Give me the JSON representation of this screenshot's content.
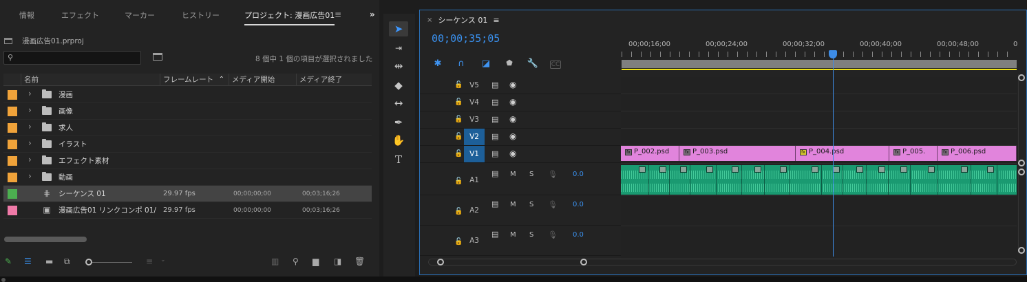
{
  "project_panel": {
    "tabs": [
      "情報",
      "エフェクト",
      "マーカー",
      "ヒストリー",
      "プロジェクト: 漫画広告01"
    ],
    "menu_icon": "hamburger-icon",
    "expand_icon": "double-chevron-right",
    "project_file": "漫画広告01.prproj",
    "search_value": "",
    "item_count_text": "8 個中 1 個の項目が選択されました",
    "columns": [
      "名前",
      "フレームレート",
      "メディア開始",
      "メディア終了"
    ],
    "items": [
      {
        "name": "漫画",
        "type": "bin",
        "color": "#f0a33a",
        "fps": "",
        "start": "",
        "end": ""
      },
      {
        "name": "画像",
        "type": "bin",
        "color": "#f0a33a",
        "fps": "",
        "start": "",
        "end": ""
      },
      {
        "name": "求人",
        "type": "bin",
        "color": "#f0a33a",
        "fps": "",
        "start": "",
        "end": ""
      },
      {
        "name": "イラスト",
        "type": "bin",
        "color": "#f0a33a",
        "fps": "",
        "start": "",
        "end": ""
      },
      {
        "name": "エフェクト素材",
        "type": "bin",
        "color": "#f0a33a",
        "fps": "",
        "start": "",
        "end": ""
      },
      {
        "name": "動画",
        "type": "bin",
        "color": "#f0a33a",
        "fps": "",
        "start": "",
        "end": ""
      },
      {
        "name": "シーケンス 01",
        "type": "sequence",
        "color": "#4caf50",
        "fps": "29.97 fps",
        "start": "00;00;00;00",
        "end": "00;03;16;26",
        "selected": true
      },
      {
        "name": "漫画広告01 リンクコンポ 01/",
        "type": "comp",
        "color": "#f07aa8",
        "fps": "29.97 fps",
        "start": "00;00;00;00",
        "end": "00;03;16;26"
      }
    ]
  },
  "timeline": {
    "tab_title": "シーケンス 01",
    "timecode": "00;00;35;05",
    "ruler_labels": [
      "00;00;16;00",
      "00;00;24;00",
      "00;00;32;00",
      "00;00;40;00",
      "00;00;48;00",
      "0"
    ],
    "video_tracks": [
      {
        "name": "V5",
        "target": false
      },
      {
        "name": "V4",
        "target": false
      },
      {
        "name": "V3",
        "target": false
      },
      {
        "name": "V2",
        "target": true
      },
      {
        "name": "V1",
        "target": true
      }
    ],
    "audio_tracks": [
      {
        "name": "A1",
        "m": "M",
        "s": "S",
        "volume": "0.0"
      },
      {
        "name": "A2",
        "m": "M",
        "s": "S",
        "volume": "0.0"
      },
      {
        "name": "A3",
        "m": "M",
        "s": "S",
        "volume": "0.0"
      }
    ],
    "v1_clips": [
      {
        "name": "P_002.psd",
        "fx": "gray"
      },
      {
        "name": "P_003.psd",
        "fx": "gray"
      },
      {
        "name": "P_004.psd",
        "fx": "yellow"
      },
      {
        "name": "P_005.",
        "fx": "gray"
      },
      {
        "name": "P_006.psd",
        "fx": "gray"
      }
    ],
    "playhead_color": "#3d8ce6",
    "work_area_color": "#f0e21a",
    "video_clip_color": "#e184dc",
    "audio_clip_color": "#1a9a71"
  },
  "accent": "#3a91ef"
}
